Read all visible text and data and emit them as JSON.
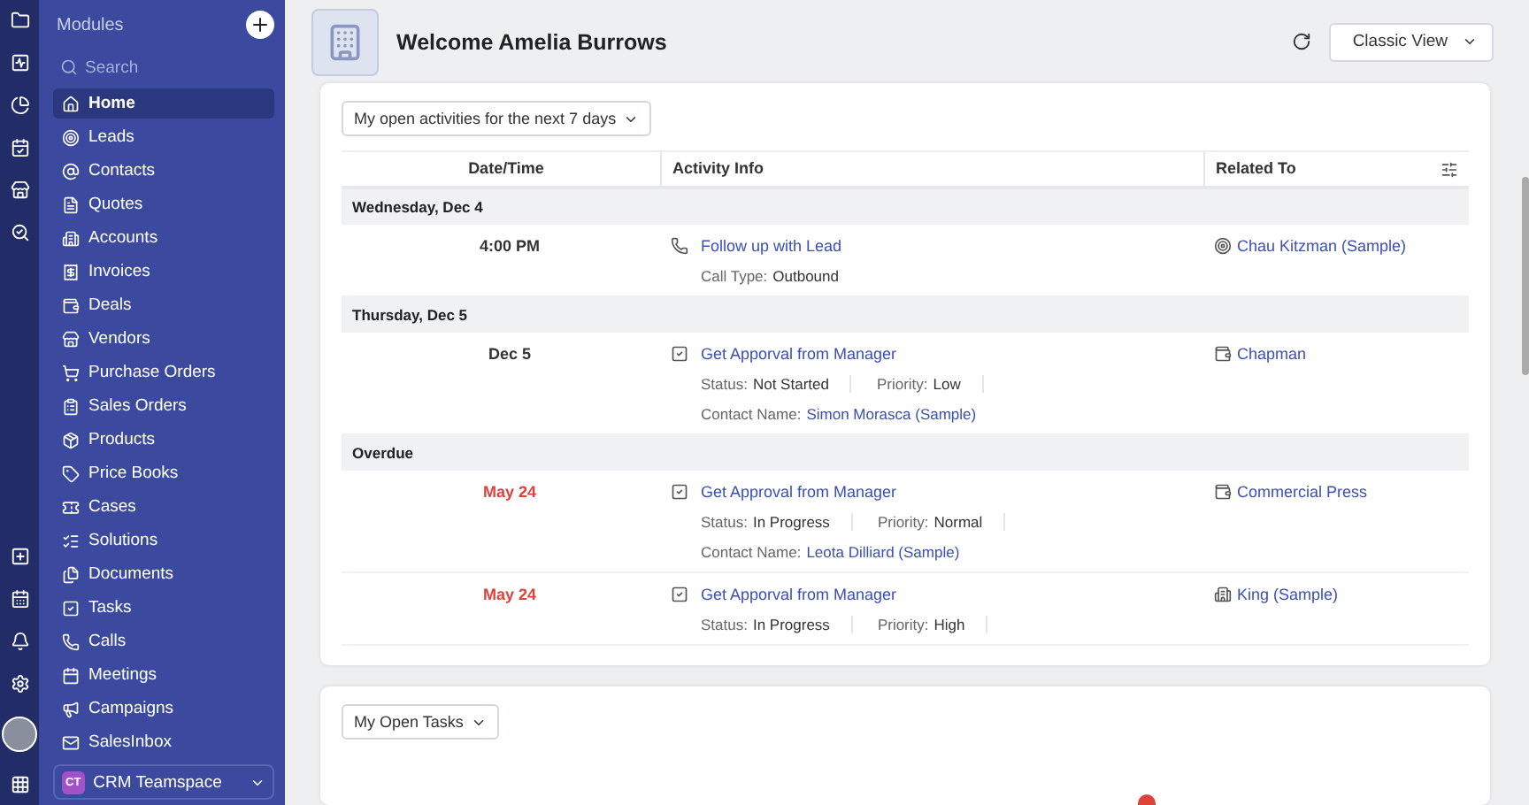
{
  "sidebar": {
    "title": "Modules",
    "search": {
      "placeholder": "Search"
    },
    "items": [
      {
        "label": "Home",
        "selected": true
      },
      {
        "label": "Leads",
        "selected": false
      },
      {
        "label": "Contacts",
        "selected": false
      },
      {
        "label": "Quotes",
        "selected": false
      },
      {
        "label": "Accounts",
        "selected": false
      },
      {
        "label": "Invoices",
        "selected": false
      },
      {
        "label": "Deals",
        "selected": false
      },
      {
        "label": "Vendors",
        "selected": false
      },
      {
        "label": "Purchase Orders",
        "selected": false
      },
      {
        "label": "Sales Orders",
        "selected": false
      },
      {
        "label": "Products",
        "selected": false
      },
      {
        "label": "Price Books",
        "selected": false
      },
      {
        "label": "Cases",
        "selected": false
      },
      {
        "label": "Solutions",
        "selected": false
      },
      {
        "label": "Documents",
        "selected": false
      },
      {
        "label": "Tasks",
        "selected": false
      },
      {
        "label": "Calls",
        "selected": false
      },
      {
        "label": "Meetings",
        "selected": false
      },
      {
        "label": "Campaigns",
        "selected": false
      },
      {
        "label": "SalesInbox",
        "selected": false
      }
    ],
    "workspace": {
      "initials": "CT",
      "name": "CRM Teamspace"
    }
  },
  "header": {
    "title": "Welcome Amelia Burrows",
    "view": "Classic View"
  },
  "activities": {
    "filter": "My open activities for the next 7 days",
    "columns": [
      "Date/Time",
      "Activity Info",
      "Related To"
    ],
    "groups": [
      {
        "title": "Wednesday, Dec 4",
        "rows": [
          {
            "date": "4:00 PM",
            "overdue": false,
            "kind": "call",
            "title": "Follow up with Lead",
            "lines": [
              [
                {
                  "label": "Call Type:",
                  "value": "Outbound",
                  "link": false
                }
              ]
            ],
            "related": {
              "kind": "lead",
              "name": "Chau Kitzman (Sample)"
            }
          }
        ]
      },
      {
        "title": "Thursday, Dec 5",
        "rows": [
          {
            "date": "Dec 5",
            "overdue": false,
            "kind": "task",
            "title": "Get Apporval from Manager",
            "lines": [
              [
                {
                  "label": "Status:",
                  "value": "Not Started",
                  "link": false
                },
                {
                  "label": "Priority:",
                  "value": "Low",
                  "link": false
                }
              ],
              [
                {
                  "label": "Contact Name:",
                  "value": "Simon Morasca (Sample)",
                  "link": true
                }
              ]
            ],
            "related": {
              "kind": "deal",
              "name": "Chapman"
            }
          }
        ]
      },
      {
        "title": "Overdue",
        "rows": [
          {
            "date": "May 24",
            "overdue": true,
            "kind": "task",
            "title": "Get Approval from Manager",
            "lines": [
              [
                {
                  "label": "Status:",
                  "value": "In Progress",
                  "link": false
                },
                {
                  "label": "Priority:",
                  "value": "Normal",
                  "link": false
                }
              ],
              [
                {
                  "label": "Contact Name:",
                  "value": "Leota Dilliard (Sample)",
                  "link": true
                }
              ]
            ],
            "related": {
              "kind": "deal",
              "name": "Commercial Press"
            }
          },
          {
            "date": "May 24",
            "overdue": true,
            "kind": "task",
            "title": "Get Apporval from Manager",
            "lines": [
              [
                {
                  "label": "Status:",
                  "value": "In Progress",
                  "link": false
                },
                {
                  "label": "Priority:",
                  "value": "High",
                  "link": false
                }
              ]
            ],
            "related": {
              "kind": "account",
              "name": "King (Sample)"
            }
          }
        ]
      }
    ]
  },
  "tasks": {
    "filter": "My Open Tasks"
  }
}
